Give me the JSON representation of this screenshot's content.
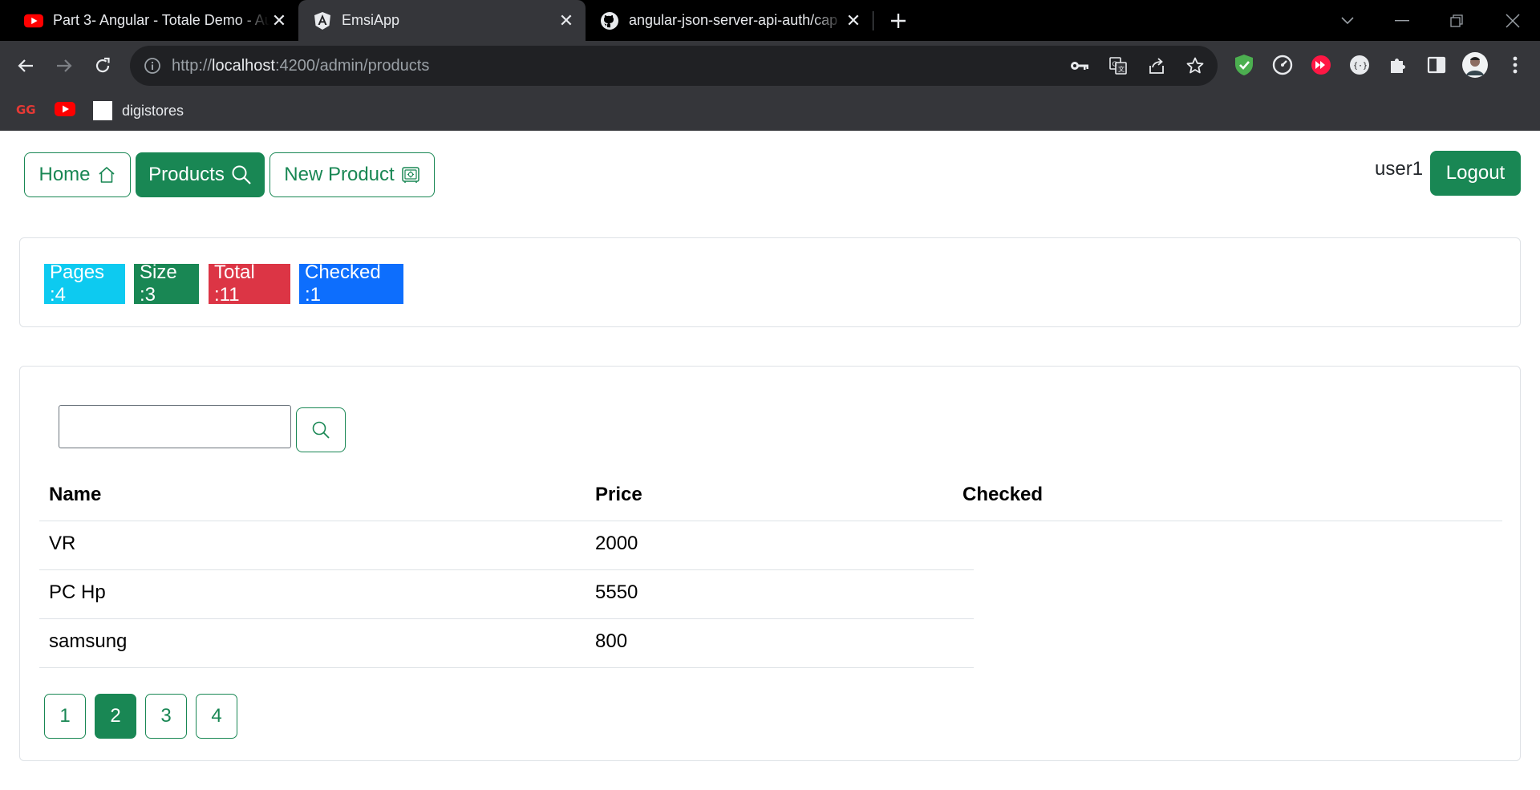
{
  "browser": {
    "tabs": [
      {
        "title": "Part 3- Angular - Totale Demo - Auth",
        "icon": "youtube-icon"
      },
      {
        "title": "EmsiApp",
        "icon": "angular-icon"
      },
      {
        "title": "angular-json-server-api-auth/cap",
        "icon": "github-icon"
      }
    ],
    "url_scheme": "http://",
    "url_host": "localhost",
    "url_rest": ":4200/admin/products",
    "bookmarks": [
      {
        "label": "",
        "icon": "gg-icon"
      },
      {
        "label": "",
        "icon": "youtube-icon"
      },
      {
        "label": "digistores",
        "icon": "digistores-icon"
      }
    ]
  },
  "nav": {
    "home_label": "Home",
    "products_label": "Products",
    "new_product_label": "New Product",
    "username": "user1",
    "logout_label": "Logout"
  },
  "stats": {
    "pages": "Pages :4",
    "size": "Size :3",
    "total": "Total :11",
    "checked": "Checked :1"
  },
  "search": {
    "value": "",
    "placeholder": ""
  },
  "table": {
    "headers": [
      "Name",
      "Price",
      "Checked"
    ],
    "rows": [
      {
        "name": "VR",
        "price": "2000"
      },
      {
        "name": "PC Hp",
        "price": "5550"
      },
      {
        "name": "samsung",
        "price": "800"
      }
    ]
  },
  "pagination": {
    "pages": [
      "1",
      "2",
      "3",
      "4"
    ],
    "current": "2"
  },
  "colors": {
    "success": "#198754",
    "info": "#0dcaf0",
    "danger": "#dc3545",
    "primary": "#0d6efd"
  }
}
